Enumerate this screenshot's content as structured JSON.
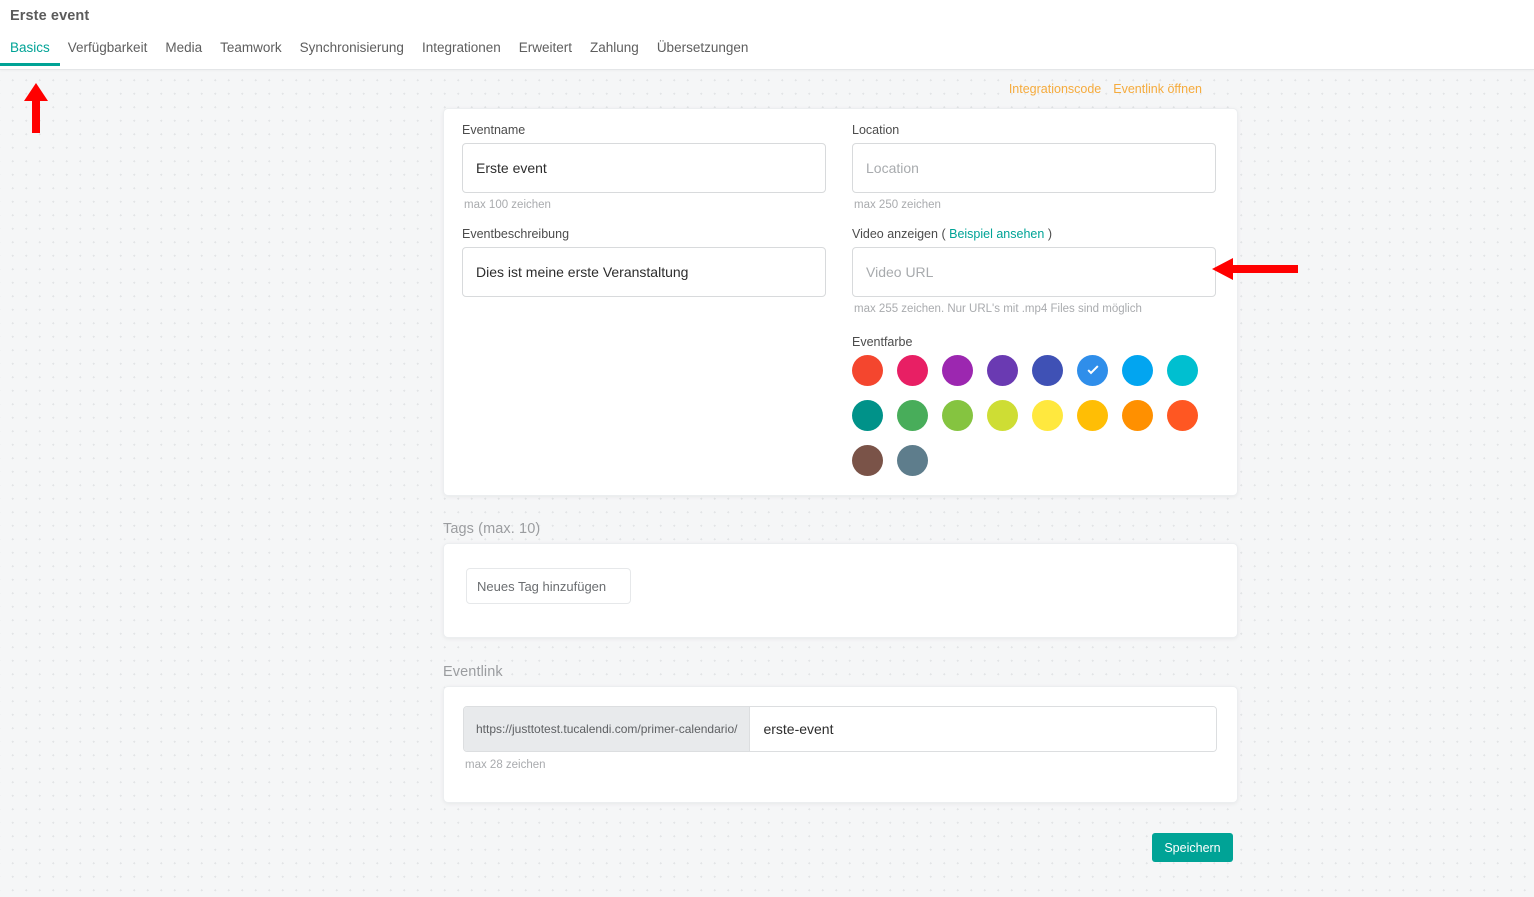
{
  "header": {
    "title": "Erste event",
    "tabs": [
      {
        "label": "Basics",
        "active": true
      },
      {
        "label": "Verfügbarkeit",
        "active": false
      },
      {
        "label": "Media",
        "active": false
      },
      {
        "label": "Teamwork",
        "active": false
      },
      {
        "label": "Synchronisierung",
        "active": false
      },
      {
        "label": "Integrationen",
        "active": false
      },
      {
        "label": "Erweitert",
        "active": false
      },
      {
        "label": "Zahlung",
        "active": false
      },
      {
        "label": "Übersetzungen",
        "active": false
      }
    ]
  },
  "toolbar": {
    "integration_code_label": "Integrationscode",
    "open_eventlink_label": "Eventlink öffnen",
    "link_color": "#f5ab3d"
  },
  "basics": {
    "eventname": {
      "label": "Eventname",
      "value": "Erste event",
      "placeholder": "",
      "hint": "max 100 zeichen"
    },
    "eventbeschreibung": {
      "label": "Eventbeschreibung",
      "value": "Dies ist meine erste Veranstaltung",
      "placeholder": "",
      "hint": ""
    },
    "location": {
      "label": "Location",
      "value": "",
      "placeholder": "Location",
      "hint": "max 250 zeichen"
    },
    "video": {
      "label": "Video anzeigen",
      "paren_open": "(",
      "example_link": "Beispiel ansehen",
      "paren_close": ")",
      "value": "",
      "placeholder": "Video URL",
      "hint": "max 255 zeichen. Nur URL's mit .mp4 Files sind möglich"
    },
    "eventfarbe": {
      "label": "Eventfarbe",
      "selected_index": 5,
      "colors": [
        "#f4462e",
        "#e81f64",
        "#9c27b0",
        "#6a3ab2",
        "#3f51b5",
        "#2f8eea",
        "#02a5f0",
        "#00bfd0",
        "#009289",
        "#48ad5a",
        "#85c440",
        "#cedd34",
        "#ffe83e",
        "#ffbe05",
        "#ff9000",
        "#ff5722",
        "#7a5348",
        "#5e7d8c"
      ]
    }
  },
  "tags": {
    "heading": "Tags (max. 10)",
    "input_placeholder": "Neues Tag hinzufügen",
    "input_value": ""
  },
  "eventlink": {
    "heading": "Eventlink",
    "url_prefix": "https://justtotest.tucalendi.com/primer-calendario/",
    "slug_value": "erste-event",
    "slug_placeholder": "",
    "hint": "max 28 zeichen"
  },
  "footer": {
    "save_label": "Speichern",
    "save_color": "#00a396"
  },
  "annotations": {
    "arrow_color": "#ff0000",
    "arrow_up_target": "Basics tab",
    "arrow_left_target": "Video URL field"
  }
}
